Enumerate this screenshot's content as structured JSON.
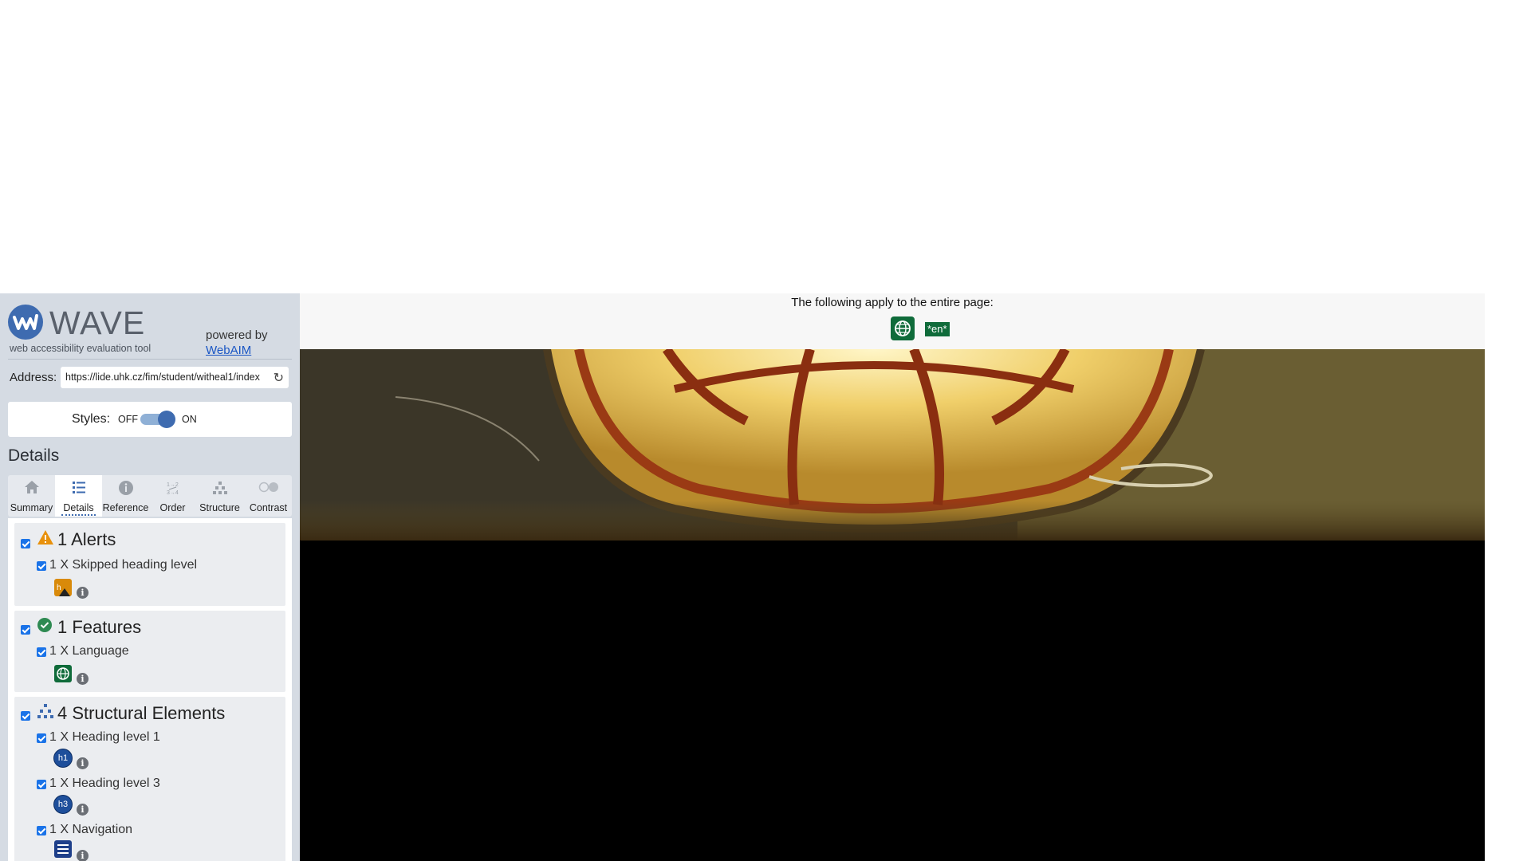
{
  "wave": {
    "logo_word": "WAVE",
    "tagline": "web accessibility evaluation tool",
    "powered_by": "powered by",
    "webaim_link": "WebAIM",
    "address_label": "Address:",
    "address_value": "https://lide.uhk.cz/fim/student/witheal1/index",
    "styles_label": "Styles:",
    "styles_off": "OFF",
    "styles_on": "ON",
    "styles_state": "on",
    "details_title": "Details",
    "tabs": [
      {
        "label": "Summary",
        "icon": "home-icon"
      },
      {
        "label": "Details",
        "icon": "list-icon",
        "active": true
      },
      {
        "label": "Reference",
        "icon": "info-icon"
      },
      {
        "label": "Order",
        "icon": "order-icon"
      },
      {
        "label": "Structure",
        "icon": "structure-icon"
      },
      {
        "label": "Contrast",
        "icon": "contrast-icon"
      }
    ],
    "categories": {
      "alerts": {
        "title": "1 Alerts",
        "items": [
          {
            "text": "1 X Skipped heading level",
            "icon": "skipped-heading-alert-icon"
          }
        ]
      },
      "features": {
        "title": "1 Features",
        "items": [
          {
            "text": "1 X Language",
            "icon": "language-icon"
          }
        ]
      },
      "structure": {
        "title": "4 Structural Elements",
        "items": [
          {
            "text": "1 X Heading level 1",
            "badge": "h1"
          },
          {
            "text": "1 X Heading level 3",
            "badge": "h3"
          },
          {
            "text": "1 X Navigation",
            "icon": "navigation-icon"
          }
        ]
      }
    }
  },
  "page": {
    "apply_text": "The following apply to the entire page:",
    "lang_badge": "*en*"
  },
  "colors": {
    "sidebar_bg": "#d5dbe3",
    "wave_blue": "#3e6bb0",
    "feature_green": "#0f6b3a",
    "alert_orange": "#e8910c"
  }
}
